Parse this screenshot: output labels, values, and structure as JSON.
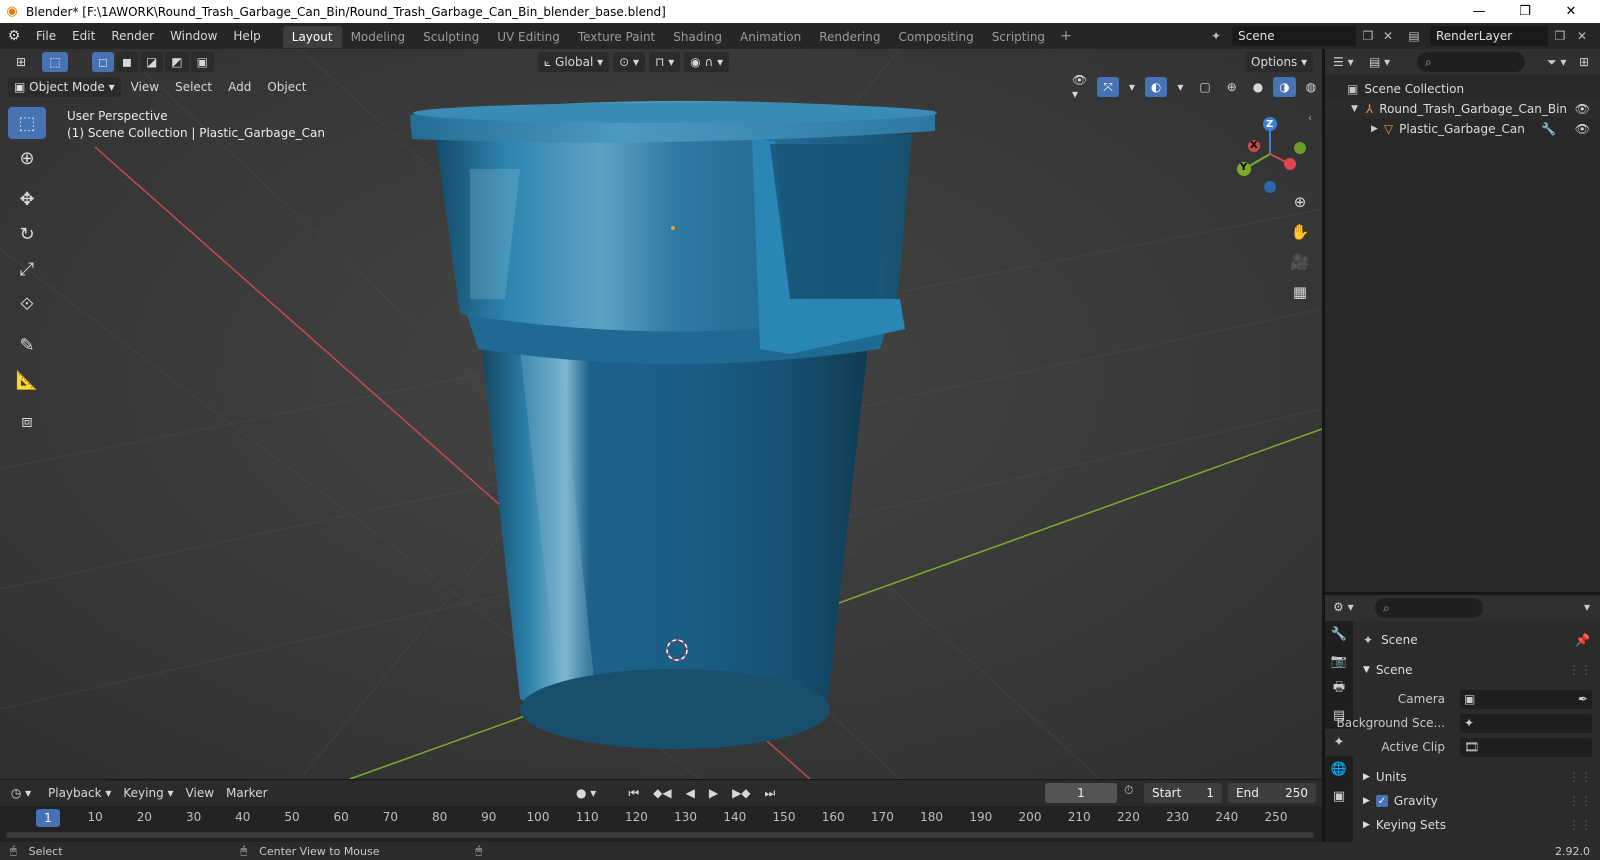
{
  "window": {
    "title": "Blender* [F:\\1AWORK\\Round_Trash_Garbage_Can_Bin/Round_Trash_Garbage_Can_Bin_blender_base.blend]",
    "minimize": "—",
    "maximize": "❐",
    "close": "✕"
  },
  "menu": [
    "File",
    "Edit",
    "Render",
    "Window",
    "Help"
  ],
  "workspaces": [
    "Layout",
    "Modeling",
    "Sculpting",
    "UV Editing",
    "Texture Paint",
    "Shading",
    "Animation",
    "Rendering",
    "Compositing",
    "Scripting"
  ],
  "active_workspace": "Layout",
  "scene_name": "Scene",
  "render_layer": "RenderLayer",
  "viewport": {
    "mode": "Object Mode",
    "menus": [
      "View",
      "Select",
      "Add",
      "Object"
    ],
    "transform": "Global",
    "options": "Options",
    "info_line1": "User Perspective",
    "info_line2": "(1) Scene Collection | Plastic_Garbage_Can"
  },
  "gizmo": {
    "z": "Z",
    "y": "Y",
    "x": "X"
  },
  "timeline": {
    "menus": [
      "Playback",
      "Keying",
      "View",
      "Marker"
    ],
    "current_frame": "1",
    "start_label": "Start",
    "start": "1",
    "end_label": "End",
    "end": "250",
    "ticks": [
      "1",
      "10",
      "20",
      "30",
      "40",
      "50",
      "60",
      "70",
      "80",
      "90",
      "100",
      "110",
      "120",
      "130",
      "140",
      "150",
      "160",
      "170",
      "180",
      "190",
      "200",
      "210",
      "220",
      "230",
      "240",
      "250"
    ]
  },
  "status": {
    "select": "Select",
    "center_view": "Center View to Mouse",
    "version": "2.92.0"
  },
  "outliner": {
    "root": "Scene Collection",
    "items": [
      {
        "name": "Round_Trash_Garbage_Can_Bin"
      },
      {
        "name": "Plastic_Garbage_Can"
      }
    ]
  },
  "properties": {
    "context": "Scene",
    "panel": "Scene",
    "camera_label": "Camera",
    "background_label": "Background Sce...",
    "active_clip_label": "Active Clip",
    "sections": [
      "Units",
      "Gravity",
      "Keying Sets"
    ],
    "gravity_checked": true
  },
  "colors": {
    "accent": "#4772b3",
    "can_blue": "#1e6a92",
    "x_axis": "#c8494d",
    "y_axis": "#7eab2a",
    "z_axis": "#3c7fd6"
  }
}
